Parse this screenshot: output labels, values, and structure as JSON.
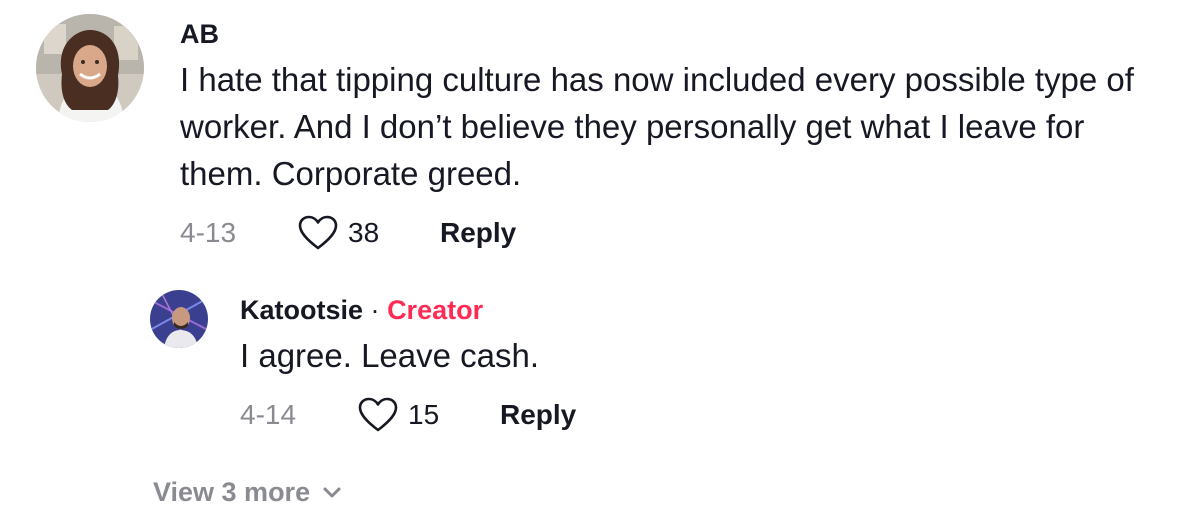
{
  "comments": [
    {
      "username": "AB",
      "text": "I hate that tipping culture has now included every possible type of worker. And I don’t believe they personally get what I leave for them. Corporate greed.",
      "date": "4-13",
      "likes": "38",
      "reply_label": "Reply"
    }
  ],
  "reply": {
    "username": "Katootsie",
    "separator": "·",
    "creator_badge": "Creator",
    "text": "I agree. Leave cash.",
    "date": "4-14",
    "likes": "15",
    "reply_label": "Reply"
  },
  "view_more_label": "View 3 more",
  "colors": {
    "creator": "#fe2c55",
    "muted": "#8a8b91",
    "text": "#161823"
  }
}
